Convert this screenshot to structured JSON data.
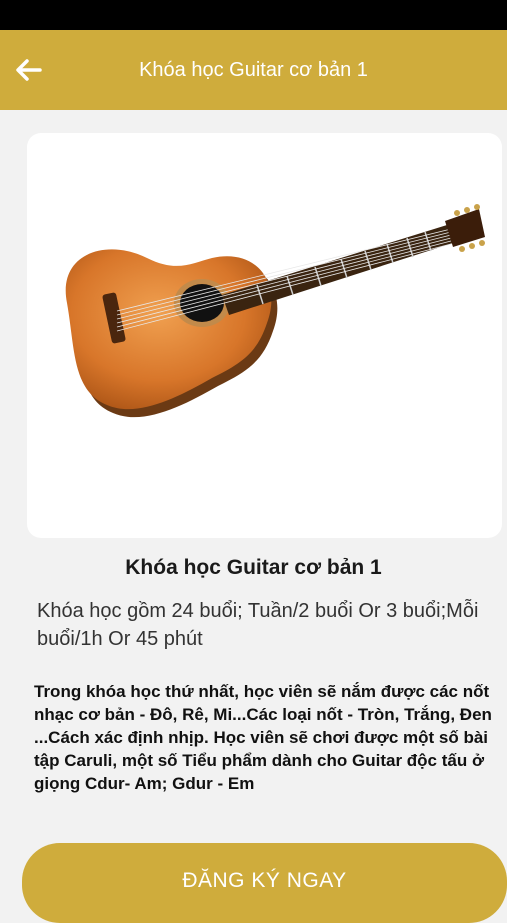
{
  "header": {
    "title": "Khóa học Guitar cơ bản 1",
    "back_icon": "arrow-left-icon"
  },
  "colors": {
    "accent": "#cfac3c",
    "background": "#f2f2f2"
  },
  "course": {
    "image": "guitar-image",
    "title": "Khóa học Guitar cơ bản 1",
    "schedule": "Khóa học gồm 24 buổi; Tuần/2 buổi Or 3 buổi;Mỗi buổi/1h Or 45 phút",
    "description": "Trong khóa học thứ nhất, học viên sẽ nắm được các nốt nhạc cơ bản - Đô, Rê, Mi...Các loại nốt - Tròn, Trắng, Đen ...Cách xác định nhịp. Học viên sẽ chơi được một số bài tập Caruli, một số Tiểu phẩm dành cho Guitar độc tấu ở giọng Cdur- Am; Gdur - Em"
  },
  "actions": {
    "register_label": "ĐĂNG KÝ NGAY"
  }
}
